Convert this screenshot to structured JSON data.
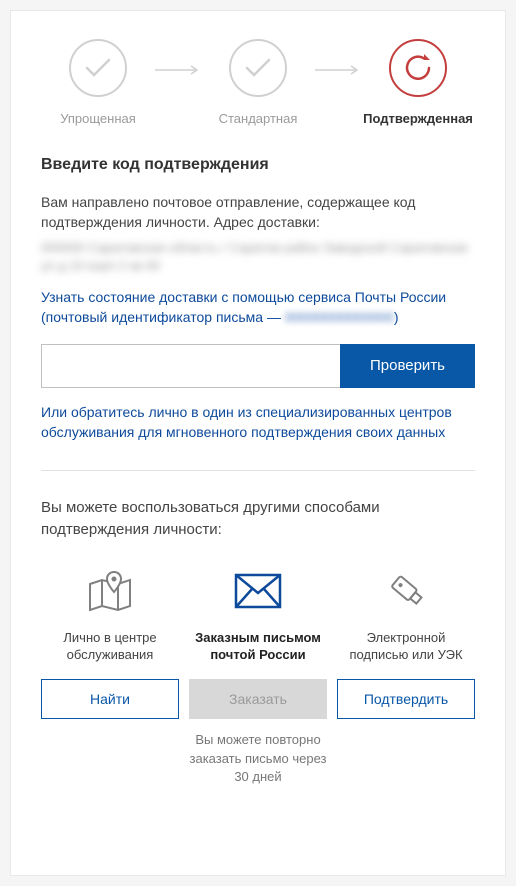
{
  "steps": {
    "s1": "Упрощенная",
    "s2": "Стандартная",
    "s3": "Подтвержденная"
  },
  "section_title": "Введите код подтверждения",
  "description": "Вам направлено почтовое отправление, содержащее код подтверждения личности. Адрес доставки:",
  "address_redacted": "000000 Саратовская область г Саратов район Заводской Саратовская ул д 10 корп 2 кв 00",
  "track_link_prefix": "Узнать состояние доставки с помощью сервиса Почты России (почтовый идентификатор письма — ",
  "track_id_blur": "00000000000000",
  "track_link_suffix": ")",
  "check_button": "Проверить",
  "centers_link": "Или обратитесь лично в один из специализированных центров обслуживания для мгновенного подтверждения своих данных",
  "alt_title": "Вы можете воспользоваться другими способами подтверждения личности:",
  "methods": {
    "m1": {
      "label": "Лично в центре обслуживания",
      "button": "Найти"
    },
    "m2": {
      "label": "Заказным письмом почтой России",
      "button": "Заказать"
    },
    "m3": {
      "label": "Электронной подписью или УЭК",
      "button": "Подтвердить"
    }
  },
  "reorder_note": "Вы можете повторно заказать письмо через 30 дней"
}
